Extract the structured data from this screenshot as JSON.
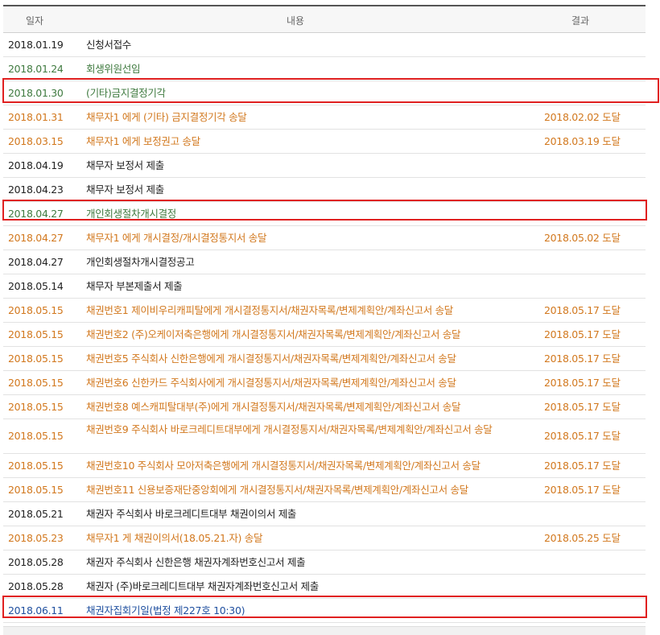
{
  "header": {
    "date": "일자",
    "content": "내용",
    "result": "결과"
  },
  "colors": {
    "black": "#222222",
    "orange": "#d2781e",
    "green": "#3f7a3f",
    "blue": "#1f4f9f",
    "highlight": "#e02020"
  },
  "rows": [
    {
      "date": "2018.01.19",
      "content": "신청서접수",
      "result": "",
      "color": "black"
    },
    {
      "date": "2018.01.24",
      "content": "회생위원선임",
      "result": "",
      "color": "green"
    },
    {
      "date": "2018.01.30",
      "content": "(기타)금지결정기각",
      "result": "",
      "color": "green"
    },
    {
      "date": "2018.01.31",
      "content": "채무자1          에게 (기타) 금지결정기각 송달",
      "result": "2018.02.02 도달",
      "color": "orange"
    },
    {
      "date": "2018.03.15",
      "content": "채무자1          에게 보정권고 송달",
      "result": "2018.03.19 도달",
      "color": "orange"
    },
    {
      "date": "2018.04.19",
      "content": "채무자          보정서 제출",
      "result": "",
      "color": "black"
    },
    {
      "date": "2018.04.23",
      "content": "채무자          보정서 제출",
      "result": "",
      "color": "black"
    },
    {
      "date": "2018.04.27",
      "content": "개인회생절차개시결정",
      "result": "",
      "color": "green"
    },
    {
      "date": "2018.04.27",
      "content": "채무자1          에게 개시결정/개시결정통지서 송달",
      "result": "2018.05.02 도달",
      "color": "orange"
    },
    {
      "date": "2018.04.27",
      "content": "개인회생절차개시결정공고",
      "result": "",
      "color": "black"
    },
    {
      "date": "2018.05.14",
      "content": "채무자          부본제출서 제출",
      "result": "",
      "color": "black"
    },
    {
      "date": "2018.05.15",
      "content": "채권번호1 제이비우리캐피탈에게 개시결정통지서/채권자목록/변제계획안/계좌신고서 송달",
      "result": "2018.05.17 도달",
      "color": "orange"
    },
    {
      "date": "2018.05.15",
      "content": "채권번호2 (주)오케이저축은행에게 개시결정통지서/채권자목록/변제계획안/계좌신고서 송달",
      "result": "2018.05.17 도달",
      "color": "orange"
    },
    {
      "date": "2018.05.15",
      "content": "채권번호5 주식회사 신한은행에게 개시결정통지서/채권자목록/변제계획안/계좌신고서 송달",
      "result": "2018.05.17 도달",
      "color": "orange"
    },
    {
      "date": "2018.05.15",
      "content": "채권번호6 신한카드 주식회사에게 개시결정통지서/채권자목록/변제계획안/계좌신고서 송달",
      "result": "2018.05.17 도달",
      "color": "orange"
    },
    {
      "date": "2018.05.15",
      "content": "채권번호8 예스캐피탈대부(주)에게 개시결정통지서/채권자목록/변제계획안/계좌신고서 송달",
      "result": "2018.05.17 도달",
      "color": "orange"
    },
    {
      "date": "2018.05.15",
      "content": "채권번호9 주식회사 바로크레디트대부에게 개시결정통지서/채권자목록/변제계획안/계좌신고서 송달",
      "result": "2018.05.17 도달",
      "color": "orange",
      "tall": true
    },
    {
      "date": "2018.05.15",
      "content": "채권번호10 주식회사 모아저축은행에게 개시결정통지서/채권자목록/변제계획안/계좌신고서 송달",
      "result": "2018.05.17 도달",
      "color": "orange"
    },
    {
      "date": "2018.05.15",
      "content": "채권번호11 신용보증재단중앙회에게 개시결정통지서/채권자목록/변제계획안/계좌신고서 송달",
      "result": "2018.05.17 도달",
      "color": "orange"
    },
    {
      "date": "2018.05.21",
      "content": "채권자 주식회사 바로크레디트대부 채권이의서 제출",
      "result": "",
      "color": "black"
    },
    {
      "date": "2018.05.23",
      "content": "채무자1          게 채권이의서(18.05.21.자) 송달",
      "result": "2018.05.25 도달",
      "color": "orange"
    },
    {
      "date": "2018.05.28",
      "content": "채권자 주식회사 신한은행 채권자계좌번호신고서 제출",
      "result": "",
      "color": "black"
    },
    {
      "date": "2018.05.28",
      "content": "채권자 (주)바로크레디트대부 채권자계좌번호신고서 제출",
      "result": "",
      "color": "black"
    },
    {
      "date": "2018.06.11",
      "content": "채권자집회기일(법정 제227호 10:30)",
      "result": "",
      "color": "blue"
    }
  ]
}
